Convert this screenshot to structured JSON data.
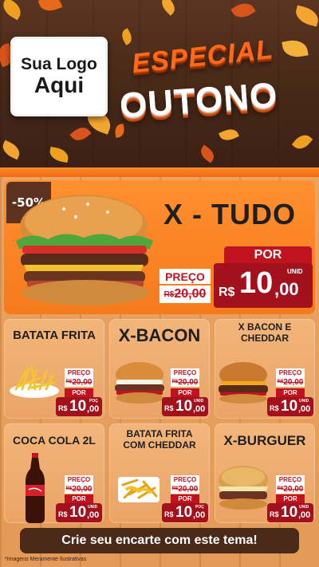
{
  "header": {
    "logo_line1": "Sua Logo",
    "logo_line2": "Aqui",
    "title_line1": "Especial",
    "title_line2": "Outono"
  },
  "featured": {
    "discount": "-50%",
    "name": "X - TUDO",
    "price_label": "PREÇO",
    "old_currency": "R$",
    "old_price": "20,00",
    "por_label": "POR",
    "currency": "R$",
    "new_price_int": "10",
    "new_price_dec": ",00",
    "unit": "UNID"
  },
  "products": [
    {
      "name": "BATATA FRITA",
      "price_label": "PREÇO",
      "old_currency": "R$",
      "old_price": "20,00",
      "por_label": "POR",
      "currency": "R$",
      "new_price_int": "10",
      "new_price_dec": ",00",
      "unit": "POÇ"
    },
    {
      "name": "X-BACON",
      "price_label": "PREÇO",
      "old_currency": "R$",
      "old_price": "20,00",
      "por_label": "POR",
      "currency": "R$",
      "new_price_int": "10",
      "new_price_dec": ",00",
      "unit": "UNID"
    },
    {
      "name": "X BACON E CHEDDAR",
      "price_label": "PREÇO",
      "old_currency": "R$",
      "old_price": "20,00",
      "por_label": "POR",
      "currency": "R$",
      "new_price_int": "10",
      "new_price_dec": ",00",
      "unit": "UNID"
    },
    {
      "name": "COCA COLA 2L",
      "price_label": "PREÇO",
      "old_currency": "R$",
      "old_price": "20,00",
      "por_label": "POR",
      "currency": "R$",
      "new_price_int": "10",
      "new_price_dec": ",00",
      "unit": "UNID"
    },
    {
      "name": "BATATA FRITA COM CHEDDAR",
      "price_label": "PREÇO",
      "old_currency": "R$",
      "old_price": "20,00",
      "por_label": "POR",
      "currency": "R$",
      "new_price_int": "10",
      "new_price_dec": ",00",
      "unit": "POÇ"
    },
    {
      "name": "X-BURGUER",
      "price_label": "PREÇO",
      "old_currency": "R$",
      "old_price": "20,00",
      "por_label": "POR",
      "currency": "R$",
      "new_price_int": "10",
      "new_price_dec": ",00",
      "unit": "UNID"
    }
  ],
  "footer": {
    "cta": "Crie seu encarte com este tema!",
    "note": "*Imagens Meramente Ilustrativas"
  },
  "colors": {
    "accent_orange": "#f57a1b",
    "price_red": "#c1121f",
    "wood_dark": "#4b2a1a"
  }
}
